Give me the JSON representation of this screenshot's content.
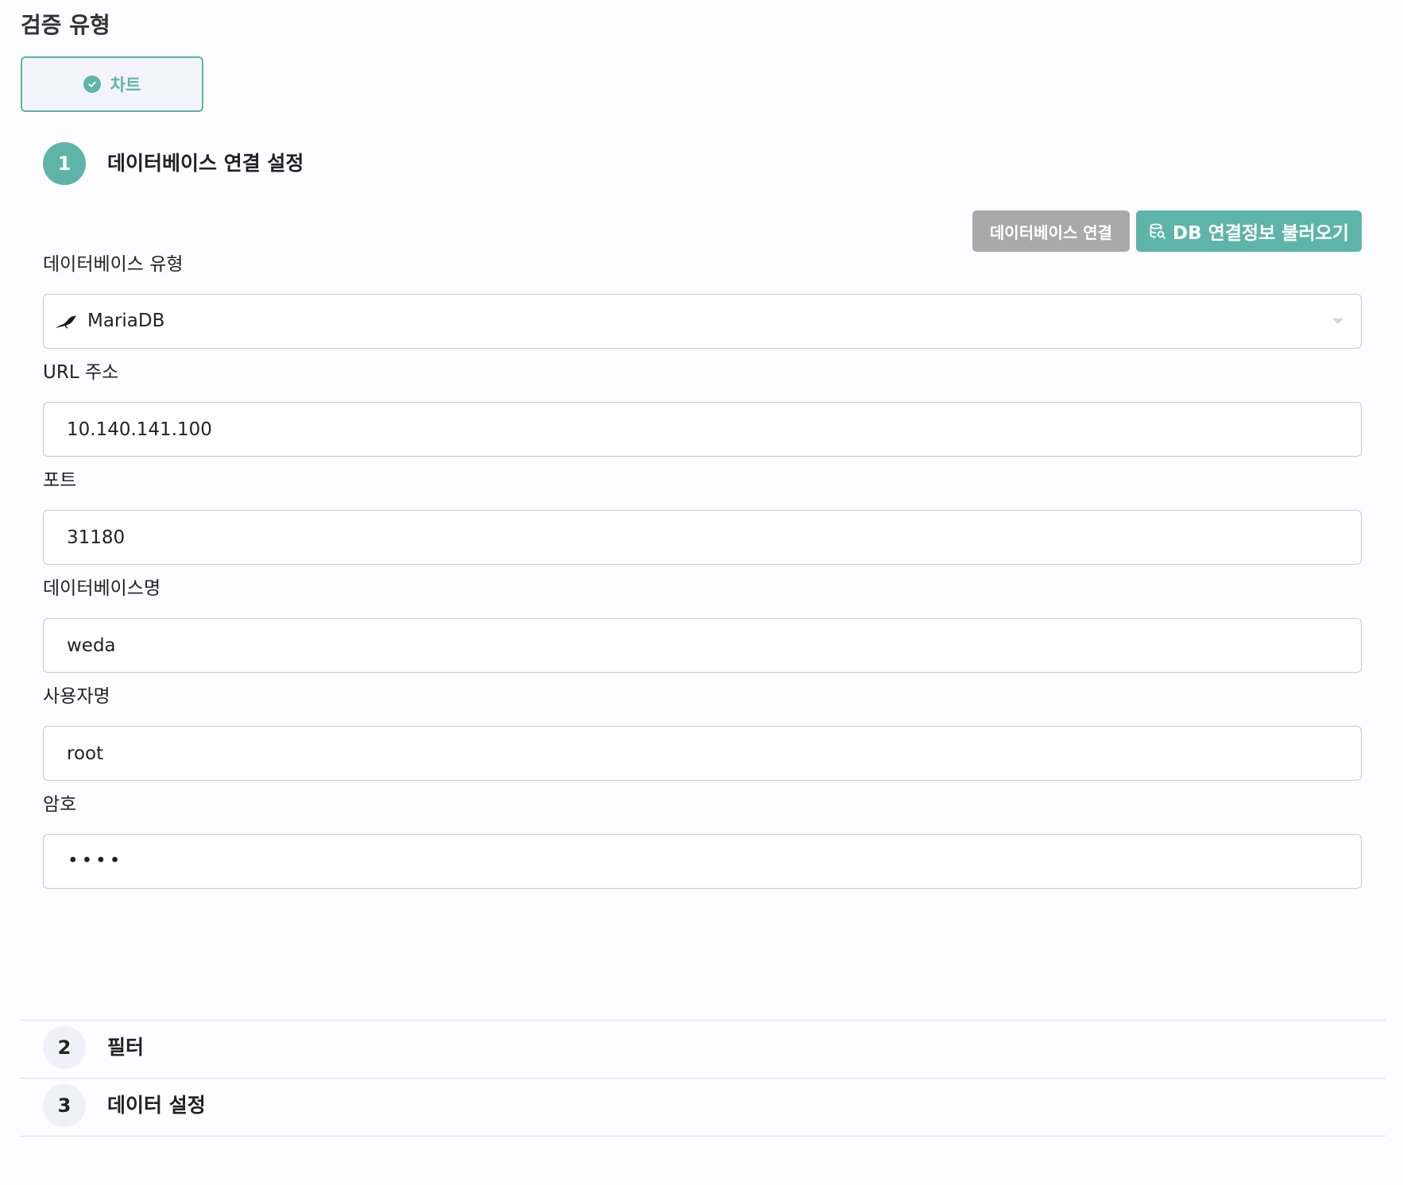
{
  "verification_type": {
    "title": "검증 유형",
    "selected_chip": "차트"
  },
  "steps": [
    {
      "number": "1",
      "title": "데이터베이스 연결 설정",
      "active": true
    },
    {
      "number": "2",
      "title": "필터",
      "active": false
    },
    {
      "number": "3",
      "title": "데이터 설정",
      "active": false
    }
  ],
  "actions": {
    "connect_label": "데이터베이스 연결",
    "load_label": "DB 연결정보 불러오기"
  },
  "form": {
    "db_type": {
      "label": "데이터베이스 유형",
      "value": "MariaDB",
      "icon": "mariadb-seal-icon"
    },
    "url": {
      "label": "URL 주소",
      "value": "10.140.141.100"
    },
    "port": {
      "label": "포트",
      "value": "31180"
    },
    "db_name": {
      "label": "데이터베이스명",
      "value": "weda"
    },
    "username": {
      "label": "사용자명",
      "value": "root"
    },
    "password": {
      "label": "암호",
      "masked_value": "••••"
    }
  },
  "colors": {
    "accent": "#5fb4a9",
    "disabled_button": "#a9a9a9",
    "chip_background": "#f3f3fb",
    "page_background": "#fdfcfe"
  }
}
